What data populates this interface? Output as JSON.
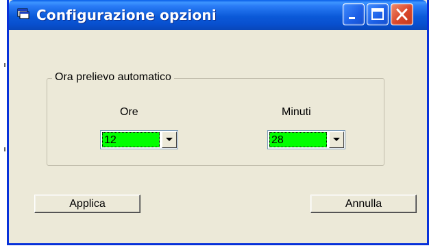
{
  "window": {
    "title": "Configurazione opzioni",
    "icon": "app-window-icon",
    "controls": [
      "minimize-icon",
      "maximize-icon",
      "close-icon"
    ]
  },
  "group": {
    "legend": "Ora prelievo automatico",
    "hours": {
      "label": "Ore",
      "value": "12"
    },
    "minutes": {
      "label": "Minuti",
      "value": "28"
    }
  },
  "buttons": {
    "apply_label": "Applica",
    "cancel_label": "Annulla"
  },
  "colors": {
    "title_bar": "#0a5fe8",
    "combo_highlight": "#00ff00",
    "close_button": "#d9462a",
    "dialog_bg": "#ece9d8"
  }
}
